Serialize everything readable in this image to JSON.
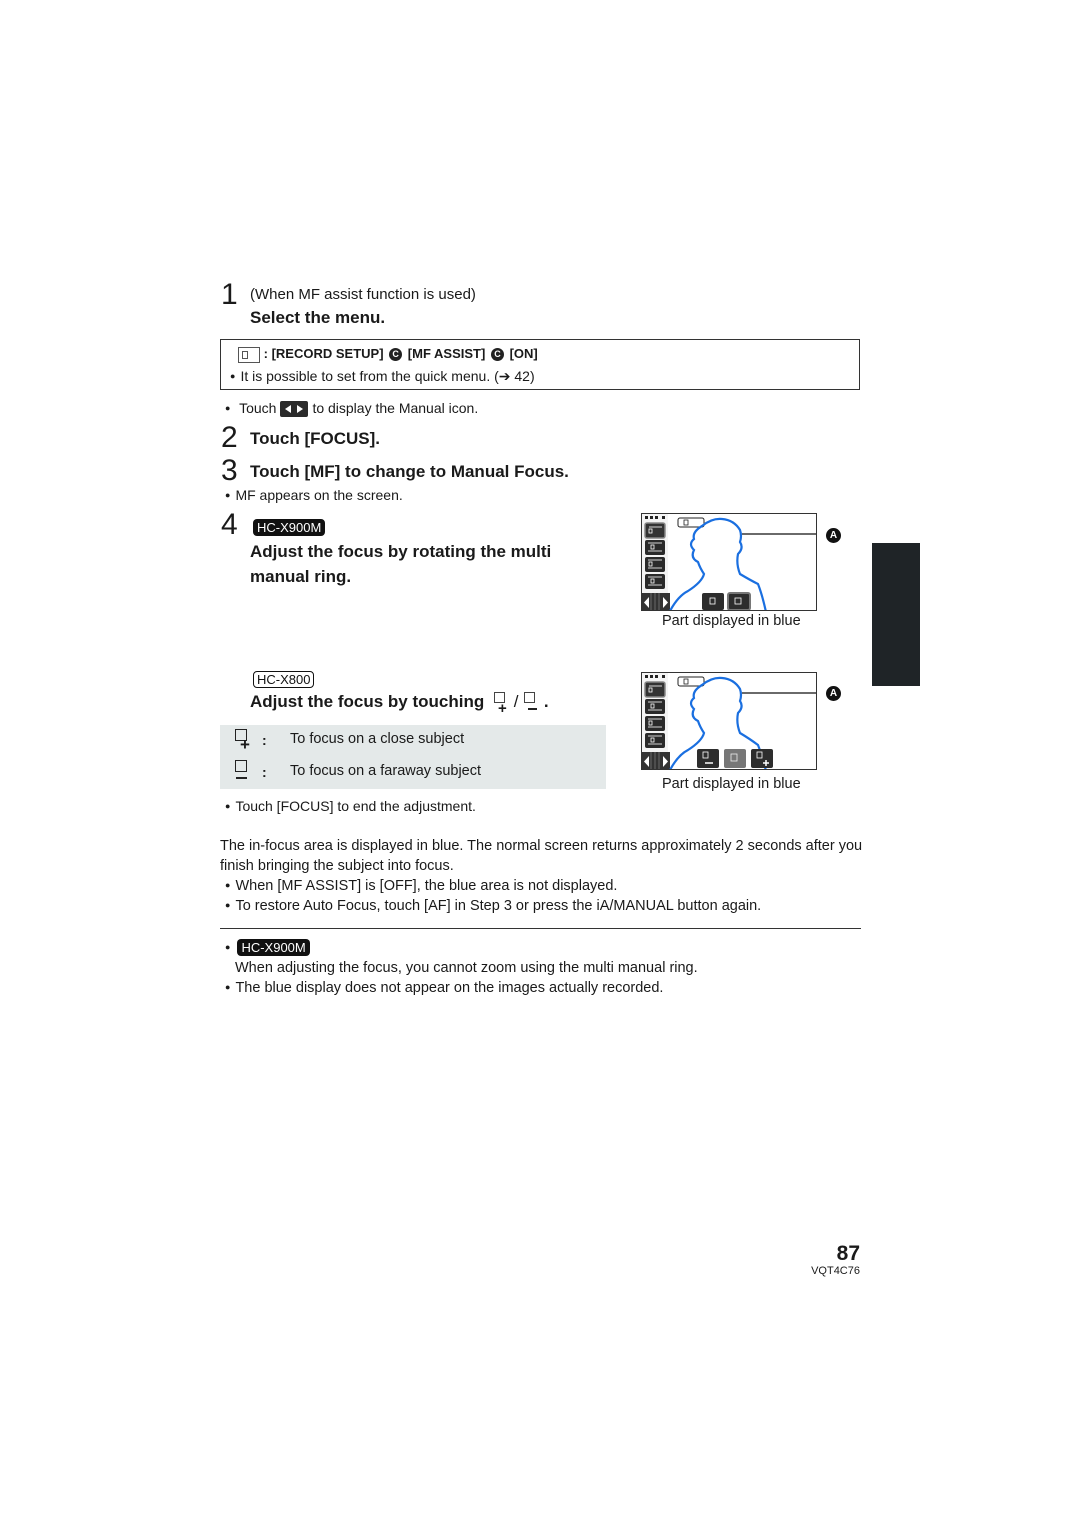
{
  "steps": [
    {
      "number": "1",
      "note": "(When MF assist function is used)",
      "title": "Select the menu."
    },
    {
      "number": "2",
      "title": "Touch [FOCUS]."
    },
    {
      "number": "3",
      "title": "Touch [MF] to change to Manual Focus."
    },
    {
      "number": "4",
      "model_badge": "HC-X900M",
      "title": "Adjust the focus by rotating the multi manual ring."
    }
  ],
  "menu_path": {
    "icon": "menu-icon",
    "separator": ":",
    "item1": "[RECORD SETUP]",
    "item2": "[MF ASSIST]",
    "item3": "[ON]",
    "arrow_glyph": "C",
    "note": "It is possible to set from the quick menu. (➔ 42)"
  },
  "touch_note": {
    "before": "Touch",
    "after": "to display the Manual icon.",
    "icon": "nav-arrows-icon"
  },
  "step3_note": "MF appears on the screen.",
  "x800": {
    "model_badge": "HC-X800",
    "title_before": "Adjust the focus by touching",
    "title_sep": "/",
    "title_end": ".",
    "table": [
      {
        "icon": "focus-near-plus-icon",
        "colon": ":",
        "text": "To focus on a close subject"
      },
      {
        "icon": "focus-far-minus-icon",
        "colon": ":",
        "text": "To focus on a faraway subject"
      }
    ],
    "end_note": "Touch [FOCUS] to end the adjustment."
  },
  "screens": [
    {
      "marker": "A",
      "caption": "Part displayed in blue",
      "blue_color": "#1a6fe0"
    },
    {
      "marker": "A",
      "caption": "Part displayed in blue",
      "blue_color": "#1a6fe0"
    }
  ],
  "paragraph": "The in-focus area is displayed in blue. The normal screen returns approximately 2 seconds after you finish bringing the subject into focus.",
  "bullets": [
    "When [MF ASSIST] is [OFF], the blue area is not displayed.",
    "To restore Auto Focus, touch [AF] in Step 3 or press the iA/MANUAL button again."
  ],
  "notes": {
    "model_badge": "HC-X900M",
    "line1": "When adjusting the focus, you cannot zoom using the multi manual ring.",
    "line2": "The blue display does not appear on the images actually recorded."
  },
  "footer": {
    "page_number": "87",
    "code": "VQT4C76"
  }
}
